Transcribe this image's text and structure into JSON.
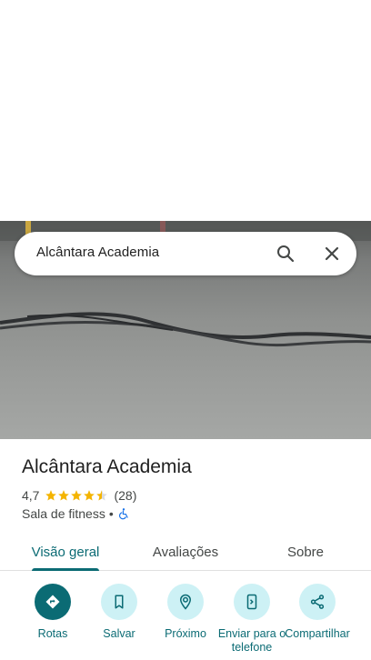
{
  "search": {
    "query": "Alcântara Academia"
  },
  "place": {
    "name": "Alcântara Academia",
    "rating": "4,7",
    "stars": 4.5,
    "review_count": "(28)",
    "category": "Sala de fitness",
    "separator": "•"
  },
  "tabs": [
    {
      "label": "Visão geral",
      "active": true
    },
    {
      "label": "Avaliações",
      "active": false
    },
    {
      "label": "Sobre",
      "active": false
    }
  ],
  "actions": [
    {
      "label": "Rotas",
      "icon": "directions-icon"
    },
    {
      "label": "Salvar",
      "icon": "bookmark-icon"
    },
    {
      "label": "Próximo",
      "icon": "nearby-icon"
    },
    {
      "label": "Enviar para o telefone",
      "icon": "send-to-phone-icon"
    },
    {
      "label": "Compartilhar",
      "icon": "share-icon"
    }
  ],
  "colors": {
    "accent": "#0b6b74",
    "accent_light": "#cdf1f5",
    "star": "#f4b400"
  }
}
